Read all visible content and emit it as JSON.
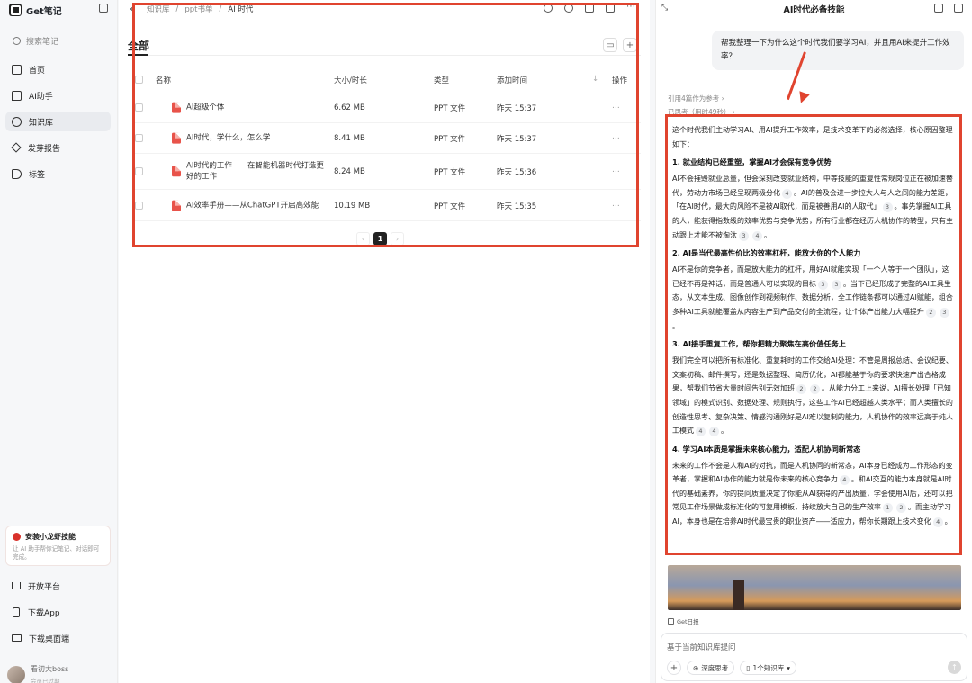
{
  "app": {
    "name": "Get笔记"
  },
  "sidebar": {
    "search_placeholder": "搜索笔记",
    "items": [
      {
        "label": "首页",
        "icon": "home-icon"
      },
      {
        "label": "AI助手",
        "icon": "chat-icon"
      },
      {
        "label": "知识库",
        "icon": "knowledge-icon",
        "active": true
      },
      {
        "label": "发芽报告",
        "icon": "sprout-icon"
      },
      {
        "label": "标签",
        "icon": "tag-icon"
      }
    ],
    "promo": {
      "title": "安装小龙虾技能",
      "desc": "让 AI 助手帮你记笔记、对话即可完成。"
    },
    "bottom": [
      {
        "label": "开放平台",
        "icon": "code-icon"
      },
      {
        "label": "下载App",
        "icon": "phone-icon"
      },
      {
        "label": "下载桌面端",
        "icon": "monitor-icon"
      }
    ],
    "user": {
      "name": "看初大boss",
      "sub": "会员已过期"
    }
  },
  "main": {
    "breadcrumb": [
      "知识库",
      "/",
      "ppt书单",
      "/",
      "AI 时代"
    ],
    "tab": "全部",
    "columns": [
      "名称",
      "大小/时长",
      "类型",
      "添加时间",
      "操作"
    ],
    "rows": [
      {
        "name": "AI超级个体",
        "size": "6.62 MB",
        "type": "PPT 文件",
        "time": "昨天 15:37"
      },
      {
        "name": "AI时代，学什么，怎么学",
        "size": "8.41 MB",
        "type": "PPT 文件",
        "time": "昨天 15:37"
      },
      {
        "name": "AI时代的工作——在智能机器时代打造更好的工作",
        "size": "8.24 MB",
        "type": "PPT 文件",
        "time": "昨天 15:36"
      },
      {
        "name": "AI效率手册——从ChatGPT开启高效能",
        "size": "10.19 MB",
        "type": "PPT 文件",
        "time": "昨天 15:35"
      }
    ],
    "pager": {
      "current": "1"
    }
  },
  "chat": {
    "title": "AI时代必备技能",
    "user_message": "帮我整理一下为什么这个时代我们要学习AI，并且用AI来提升工作效率？",
    "refs": "引用4篇作为参考 ›",
    "thinking": "已思考（用时49秒） ›",
    "answer": {
      "intro": "这个时代我们主动学习AI、用AI提升工作效率，是技术变革下的必然选择，核心原因整理如下：",
      "sections": [
        {
          "h": "1. 就业结构已经重塑，掌握AI才会保有竞争优势",
          "p": "AI不会摧毁就业总量，但会深刻改变就业结构，中等技能的重复性常规岗位正在被加速替代，劳动力市场已经呈现两极分化",
          "c1": "4",
          "p2": "。AI的普及会进一步拉大人与人之间的能力差距，「在AI时代，最大的风险不是被AI取代，而是被善用AI的人取代」",
          "c2": "3",
          "p3": "。事先掌握AI工具的人，能获得指数级的效率优势与竞争优势，所有行业都在经历人机协作的转型，只有主动跟上才能不被淘汰",
          "c3": "3",
          "c4": "4"
        },
        {
          "h": "2. AI是当代最高性价比的效率杠杆，能放大你的个人能力",
          "p": "AI不是你的竞争者，而是放大能力的杠杆，用好AI就能实现「一个人等于一个团队」，这已经不再是神话，而是普通人可以实现的目标",
          "c1": "3",
          "c2": "3",
          "p2": "。当下已经形成了完整的AI工具生态，从文本生成、图像创作到视频制作、数据分析，全工作链条都可以通过AI赋能，组合多种AI工具就能覆盖从内容生产到产品交付的全流程，让个体产出能力大幅提升",
          "c3": "2",
          "c4": "3"
        },
        {
          "h": "3. AI接手重复工作，帮你把精力聚焦在高价值任务上",
          "p": "我们完全可以把所有标准化、重复耗时的工作交给AI处理：不管是周报总结、会议纪要、文案初稿、邮件撰写，还是数据整理、简历优化，AI都能基于你的要求快速产出合格成果，帮我们节省大量时间告别无效加班",
          "c1": "2",
          "c2": "2",
          "p2": "。从能力分工上来说，AI擅长处理「已知领域」的模式识别、数据处理、规则执行，这些工作AI已经超越人类水平；而人类擅长的创造性思考、复杂决策、情感沟通刚好是AI难以复制的能力，人机协作的效率远高于纯人工模式",
          "c3": "4",
          "c4": "4"
        },
        {
          "h": "4. 学习AI本质是掌握未来核心能力，适配人机协同新常态",
          "p": "未来的工作不会是人和AI的对抗，而是人机协同的新常态，AI本身已经成为工作形态的变革者，掌握和AI协作的能力就是你未来的核心竞争力",
          "c1": "4",
          "p2": "。和AI交互的能力本身就是AI时代的基础素养，你的提问质量决定了你能从AI获得的产出质量，学会使用AI后，还可以把常见工作场景做成标准化的可复用模板，持续放大自己的生产效率",
          "c2": "1",
          "c3": "2",
          "p3": "。而主动学习AI，本身也是在培养AI时代最宝贵的职业资产——适应力，帮你长期跟上技术变化",
          "c4": "4"
        }
      ]
    },
    "source": "Get日报",
    "input_placeholder": "基于当前知识库提问",
    "chips": [
      "深度思考",
      "1个知识库"
    ]
  },
  "colors": {
    "annotation": "#e0442f",
    "ppt": "#e8534a"
  }
}
